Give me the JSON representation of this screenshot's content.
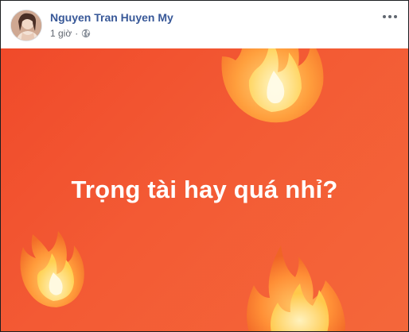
{
  "post": {
    "author_name": "Nguyen Tran Huyen My",
    "timestamp": "1 giờ",
    "separator": "·",
    "privacy_icon": "globe-icon",
    "options_icon": "more-options-icon"
  },
  "status": {
    "text": "Trọng tài hay quá nhỉ?",
    "background_color": "#f35a34",
    "text_color": "#ffffff",
    "decorations": [
      "fire-emoji-top-right",
      "fire-emoji-bottom-left",
      "fire-emoji-bottom-right"
    ]
  },
  "colors": {
    "author_link": "#385898",
    "meta_text": "#616770"
  }
}
